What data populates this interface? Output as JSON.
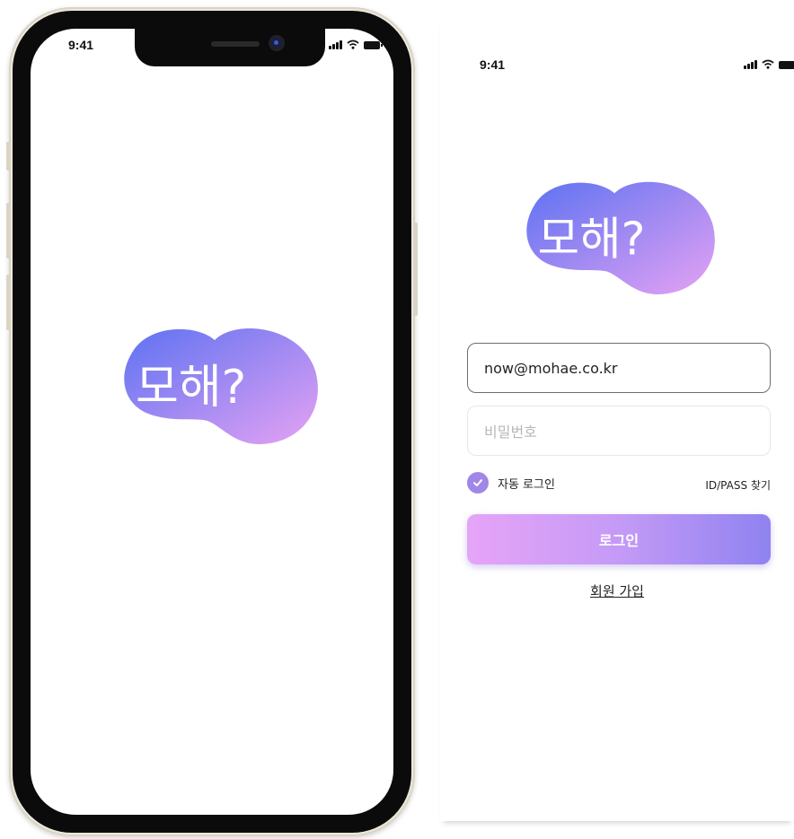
{
  "status_bar": {
    "time": "9:41"
  },
  "logo": {
    "text": "모해?",
    "gradient_start": "#5d72f2",
    "gradient_end": "#e5a2f3"
  },
  "login": {
    "email_value": "now@mohae.co.kr",
    "password_placeholder": "비밀번호",
    "auto_login_label": "자동 로그인",
    "auto_login_checked": true,
    "find_account_link": "ID/PASS 찾기",
    "login_button": "로그인",
    "signup_link": "회원 가입"
  },
  "colors": {
    "accent": "#9f86e8",
    "button_gradient_left": "#e6a4f7",
    "button_gradient_right": "#8f83f0",
    "phone_frame": "#ece8dc"
  },
  "icons": {
    "signal": "cellular-signal-icon",
    "wifi": "wifi-icon",
    "battery": "battery-icon",
    "checkbox": "checkmark-icon"
  }
}
